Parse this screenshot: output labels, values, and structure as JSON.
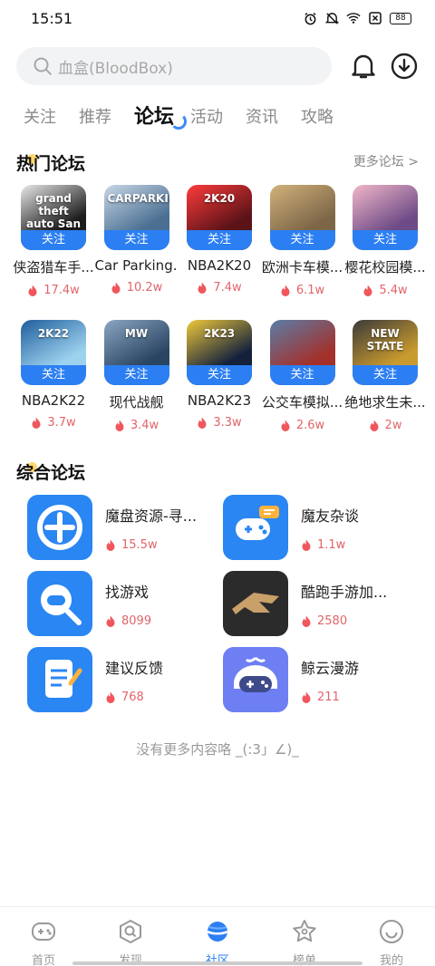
{
  "status_bar": {
    "time": "15:51",
    "battery": "88",
    "icons": [
      "alarm-icon",
      "mute-icon",
      "wifi-icon",
      "no-sim-icon",
      "battery-icon"
    ]
  },
  "search": {
    "placeholder": "血盒(BloodBox)"
  },
  "tabs": [
    "关注",
    "推荐",
    "论坛",
    "活动",
    "资讯",
    "攻略"
  ],
  "active_tab": "论坛",
  "hot_forums": {
    "title": "热门论坛",
    "more_label": "更多论坛 >",
    "follow_label": "关注",
    "games": [
      {
        "name": "侠盗猎车手...",
        "heat": "17.4w",
        "color": "#1c1c1c",
        "accent": "#e9e9e9",
        "label": "grand theft auto San Andreas"
      },
      {
        "name": "Car Parking...",
        "heat": "10.2w",
        "color": "#4a6f92",
        "accent": "#c9d7e6",
        "label": "CARPARKING"
      },
      {
        "name": "NBA2K20",
        "heat": "7.4w",
        "color": "#5b1318",
        "accent": "#ff3b3b",
        "label": "2K20"
      },
      {
        "name": "欧洲卡车模...",
        "heat": "6.1w",
        "color": "#7d6648",
        "accent": "#d2b27a",
        "label": ""
      },
      {
        "name": "樱花校园模...",
        "heat": "5.4w",
        "color": "#6d4b86",
        "accent": "#f2b7c9",
        "label": ""
      },
      {
        "name": "NBA2K22",
        "heat": "3.7w",
        "color": "#9dd2ef",
        "accent": "#1f5d9c",
        "label": "2K22"
      },
      {
        "name": "现代战舰",
        "heat": "3.4w",
        "color": "#2a4562",
        "accent": "#8aa6c2",
        "label": "MW"
      },
      {
        "name": "NBA2K23",
        "heat": "3.3w",
        "color": "#13213d",
        "accent": "#f0c93a",
        "label": "2K23"
      },
      {
        "name": "公交车模拟...",
        "heat": "2.6w",
        "color": "#a3302b",
        "accent": "#5a7ea8",
        "label": ""
      },
      {
        "name": "绝地求生未...",
        "heat": "2w",
        "color": "#c99a2e",
        "accent": "#3a3a3a",
        "label": "NEW STATE"
      }
    ]
  },
  "general_forums": {
    "title": "综合论坛",
    "items": [
      {
        "name": "魔盘资源-寻...",
        "heat": "15.5w",
        "color": "#2a86f2",
        "icon": "tool-disc-icon"
      },
      {
        "name": "魔友杂谈",
        "heat": "1.1w",
        "color": "#2a86f2",
        "icon": "gamepad-chat-icon"
      },
      {
        "name": "找游戏",
        "heat": "8099",
        "color": "#2a86f2",
        "icon": "search-gamepad-icon"
      },
      {
        "name": "酷跑手游加...",
        "heat": "2580",
        "color": "#2b2b2b",
        "icon": "kupao-logo-icon"
      },
      {
        "name": "建议反馈",
        "heat": "768",
        "color": "#2a86f2",
        "icon": "feedback-doc-icon"
      },
      {
        "name": "鲸云漫游",
        "heat": "211",
        "color": "#6d7ff2",
        "icon": "whale-gamepad-icon"
      }
    ]
  },
  "end_text": "没有更多内容咯 _(:3」∠)_",
  "nav": [
    {
      "label": "首页",
      "icon": "home-gamepad-icon",
      "active": false
    },
    {
      "label": "发现",
      "icon": "discover-icon",
      "active": false
    },
    {
      "label": "社区",
      "icon": "planet-icon",
      "active": true
    },
    {
      "label": "榜单",
      "icon": "star-icon",
      "active": false
    },
    {
      "label": "我的",
      "icon": "smile-icon",
      "active": false
    }
  ],
  "colors": {
    "accent": "#2c7ff3",
    "heat": "#e0656a"
  }
}
